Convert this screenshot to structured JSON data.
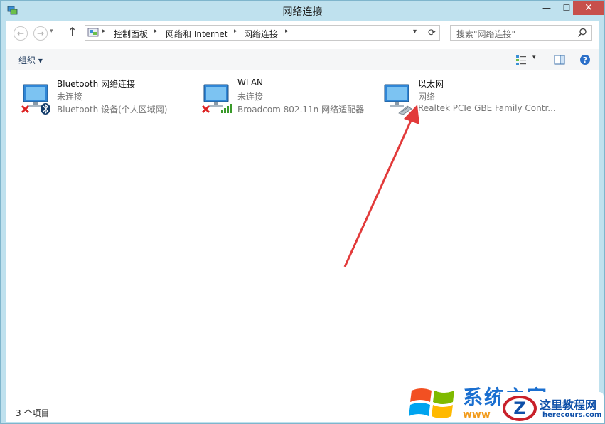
{
  "window": {
    "title": "网络连接",
    "controls": {
      "minimize": "—",
      "maximize": "☐",
      "close": "✕"
    }
  },
  "nav": {
    "back": "←",
    "forward": "→",
    "history": "▾",
    "up": "↑",
    "breadcrumbs": [
      "控制面板",
      "网络和 Internet",
      "网络连接"
    ],
    "separator": "▸",
    "address_dropdown": "▾",
    "refresh": "⟳",
    "search_placeholder": "搜索\"网络连接\""
  },
  "toolbar": {
    "organize": "组织 ▾",
    "view_dropdown": "▾"
  },
  "connections": [
    {
      "name": "Bluetooth 网络连接",
      "status": "未连接",
      "device": "Bluetooth 设备(个人区域网)",
      "badge": "bluetooth-icon",
      "error": true
    },
    {
      "name": "WLAN",
      "status": "未连接",
      "device": "Broadcom 802.11n 网络适配器",
      "badge": "signal-bars-icon",
      "error": true
    },
    {
      "name": "以太网",
      "status": "网络",
      "device": "Realtek PCIe GBE Family Contr...",
      "badge": "ethernet-cable-icon",
      "error": false
    }
  ],
  "status_bar": {
    "count": "3 个项目"
  },
  "colors": {
    "accent": "#1e395b",
    "close": "#c7504b",
    "arrow": "#e23a3a",
    "frame": "#bfe1ee"
  },
  "watermark": {
    "brand": "系统之家",
    "url1": "www",
    "name": "这里教程网",
    "url2": "herecours.com"
  }
}
